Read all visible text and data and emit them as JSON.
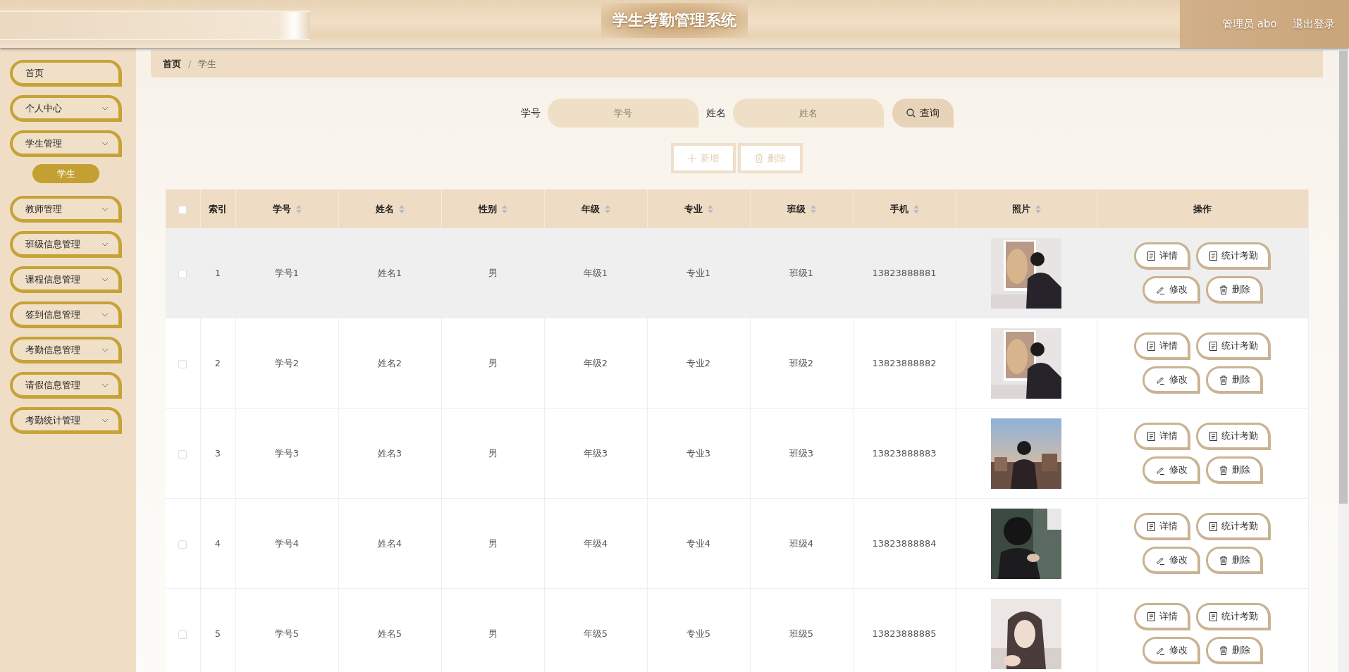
{
  "header": {
    "title": "学生考勤管理系统",
    "user": "管理员 abo",
    "logout": "退出登录"
  },
  "sidebar": {
    "items": [
      {
        "label": "首页",
        "kind": "link"
      },
      {
        "label": "个人中心",
        "kind": "submenu"
      },
      {
        "label": "学生管理",
        "kind": "submenu",
        "children": [
          {
            "label": "学生",
            "selected": true
          }
        ]
      },
      {
        "label": "教师管理",
        "kind": "submenu"
      },
      {
        "label": "班级信息管理",
        "kind": "submenu"
      },
      {
        "label": "课程信息管理",
        "kind": "submenu"
      },
      {
        "label": "签到信息管理",
        "kind": "submenu"
      },
      {
        "label": "考勤信息管理",
        "kind": "submenu"
      },
      {
        "label": "请假信息管理",
        "kind": "submenu"
      },
      {
        "label": "考勤统计管理",
        "kind": "submenu"
      }
    ]
  },
  "breadcrumb": {
    "items": [
      "首页",
      "学生"
    ],
    "separator": "/"
  },
  "search": {
    "fields": [
      {
        "label": "学号",
        "placeholder": "学号"
      },
      {
        "label": "姓名",
        "placeholder": "姓名"
      }
    ],
    "button": "查询"
  },
  "toolbar": [
    {
      "label": "新增",
      "kind": "add",
      "disabled": true
    },
    {
      "label": "删除",
      "kind": "delete",
      "disabled": true
    }
  ],
  "table": {
    "select_all": {
      "checked": false
    },
    "columns": [
      {
        "label": "索引",
        "sortable": false
      },
      {
        "label": "学号",
        "sortable": true
      },
      {
        "label": "姓名",
        "sortable": true
      },
      {
        "label": "性别",
        "sortable": true
      },
      {
        "label": "年级",
        "sortable": true
      },
      {
        "label": "专业",
        "sortable": true
      },
      {
        "label": "班级",
        "sortable": true
      },
      {
        "label": "手机",
        "sortable": true
      },
      {
        "label": "照片",
        "sortable": true
      },
      {
        "label": "操作",
        "sortable": false
      }
    ],
    "rows": [
      {
        "checked": false,
        "highlighted": true,
        "cells": [
          "1",
          "学号1",
          "姓名1",
          "男",
          "年级1",
          "专业1",
          "班级1",
          "13823888881"
        ],
        "photo": {
          "kind": "picture"
        },
        "actions": [
          {
            "kind": "detail",
            "label": "详情"
          },
          {
            "kind": "stats",
            "label": "统计考勤"
          },
          {
            "kind": "edit",
            "label": "修改"
          },
          {
            "kind": "delete",
            "label": "删除"
          }
        ]
      },
      {
        "checked": false,
        "highlighted": false,
        "cells": [
          "2",
          "学号2",
          "姓名2",
          "男",
          "年级2",
          "专业2",
          "班级2",
          "13823888882"
        ],
        "photo": {
          "kind": "picture"
        },
        "actions": [
          {
            "kind": "detail",
            "label": "详情"
          },
          {
            "kind": "stats",
            "label": "统计考勤"
          },
          {
            "kind": "edit",
            "label": "修改"
          },
          {
            "kind": "delete",
            "label": "删除"
          }
        ]
      },
      {
        "checked": false,
        "highlighted": false,
        "cells": [
          "3",
          "学号3",
          "姓名3",
          "男",
          "年级3",
          "专业3",
          "班级3",
          "13823888883"
        ],
        "photo": {
          "kind": "picture"
        },
        "actions": [
          {
            "kind": "detail",
            "label": "详情"
          },
          {
            "kind": "stats",
            "label": "统计考勤"
          },
          {
            "kind": "edit",
            "label": "修改"
          },
          {
            "kind": "delete",
            "label": "删除"
          }
        ]
      },
      {
        "checked": false,
        "highlighted": false,
        "cells": [
          "4",
          "学号4",
          "姓名4",
          "男",
          "年级4",
          "专业4",
          "班级4",
          "13823888884"
        ],
        "photo": {
          "kind": "picture"
        },
        "actions": [
          {
            "kind": "detail",
            "label": "详情"
          },
          {
            "kind": "stats",
            "label": "统计考勤"
          },
          {
            "kind": "edit",
            "label": "修改"
          },
          {
            "kind": "delete",
            "label": "删除"
          }
        ]
      },
      {
        "checked": false,
        "highlighted": false,
        "cells": [
          "5",
          "学号5",
          "姓名5",
          "男",
          "年级5",
          "专业5",
          "班级5",
          "13823888885"
        ],
        "photo": {
          "kind": "picture"
        },
        "actions": [
          {
            "kind": "detail",
            "label": "详情"
          },
          {
            "kind": "stats",
            "label": "统计考勤"
          },
          {
            "kind": "edit",
            "label": "修改"
          },
          {
            "kind": "delete",
            "label": "删除"
          }
        ]
      }
    ]
  }
}
